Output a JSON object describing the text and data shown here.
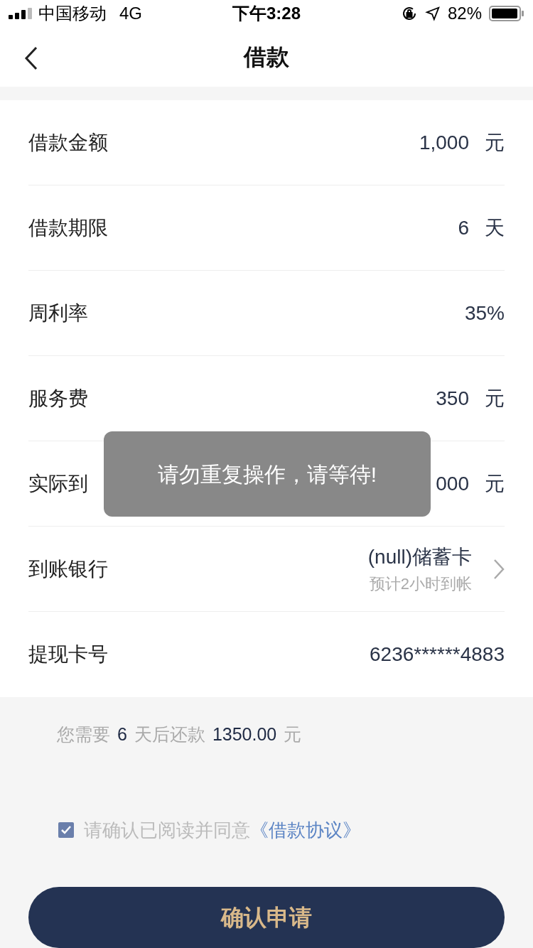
{
  "status_bar": {
    "carrier": "中国移动",
    "network": "4G",
    "time": "下午3:28",
    "battery": "82%"
  },
  "nav": {
    "title": "借款"
  },
  "rows": [
    {
      "kind": "plain",
      "label": "借款金额",
      "value": "1,000",
      "unit": "元"
    },
    {
      "kind": "plain",
      "label": "借款期限",
      "value": "6",
      "unit": "天"
    },
    {
      "kind": "plain",
      "label": "周利率",
      "value": "35%"
    },
    {
      "kind": "plain",
      "label": "服务费",
      "value": "350",
      "unit": "元"
    },
    {
      "kind": "plain",
      "label": "实际到",
      "value": "000",
      "unit": "元"
    },
    {
      "kind": "link",
      "label": "到账银行",
      "value": "(null)储蓄卡",
      "note": "预计2小时到帐"
    },
    {
      "kind": "plain",
      "label": "提现卡号",
      "value": "6236******4883"
    }
  ],
  "summary": [
    {
      "text": "您需要",
      "em": false
    },
    {
      "text": "6",
      "em": true
    },
    {
      "text": "天后还款",
      "em": false
    },
    {
      "text": "1350.00",
      "em": true
    },
    {
      "text": "元",
      "em": false
    }
  ],
  "agreement": {
    "checked": true,
    "text": "请确认已阅读并同意",
    "link": "《借款协议》"
  },
  "submit": "确认申请",
  "toast": "请勿重复操作，请等待!"
}
